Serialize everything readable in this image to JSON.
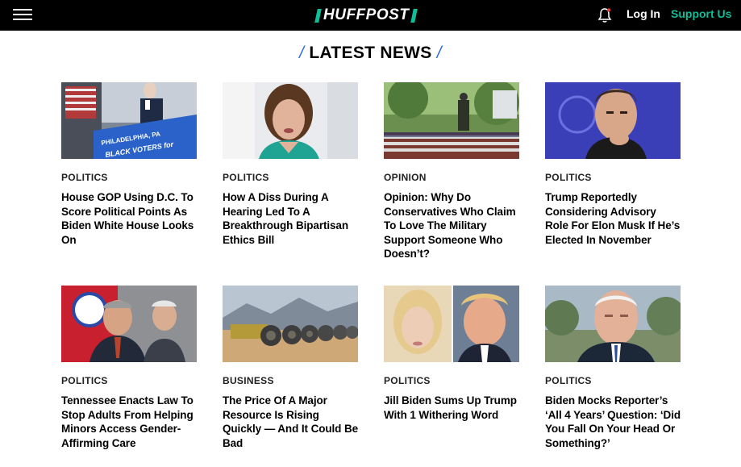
{
  "header": {
    "logo_text": "HUFFPOST",
    "login_label": "Log In",
    "support_label": "Support Us",
    "accent_color": "#0dbe98"
  },
  "section": {
    "title": "LATEST NEWS",
    "slash_color": "#2d6cdf"
  },
  "articles": [
    {
      "kicker": "POLITICS",
      "headline": "House GOP Using D.C. To Score Political Points As Biden White House Looks On",
      "image": "biden-podium-philadelphia"
    },
    {
      "kicker": "POLITICS",
      "headline": "How A Diss During A Hearing Led To A Breakthrough Bipartisan Ethics Bill",
      "image": "woman-at-hearing"
    },
    {
      "kicker": "OPINION",
      "headline": "Opinion: Why Do Conservatives Who Claim To Love The Military Support Someone Who Doesn’t?",
      "image": "soldier-flags-memorial"
    },
    {
      "kicker": "POLITICS",
      "headline": "Trump Reportedly Considering Advisory Role For Elon Musk If He’s Elected In November",
      "image": "elon-musk-portrait"
    },
    {
      "kicker": "POLITICS",
      "headline": "Tennessee Enacts Law To Stop Adults From Helping Minors Access Gender-Affirming Care",
      "image": "tennessee-governor"
    },
    {
      "kicker": "BUSINESS",
      "headline": "The Price Of A Major Resource Is Rising Quickly — And It Could Be Bad",
      "image": "pipes-in-desert"
    },
    {
      "kicker": "POLITICS",
      "headline": "Jill Biden Sums Up Trump With 1 Withering Word",
      "image": "jill-biden-trump"
    },
    {
      "kicker": "POLITICS",
      "headline": "Biden Mocks Reporter’s ‘All 4 Years’ Question: ‘Did You Fall On Your Head Or Something?’",
      "image": "biden-outdoors"
    }
  ]
}
